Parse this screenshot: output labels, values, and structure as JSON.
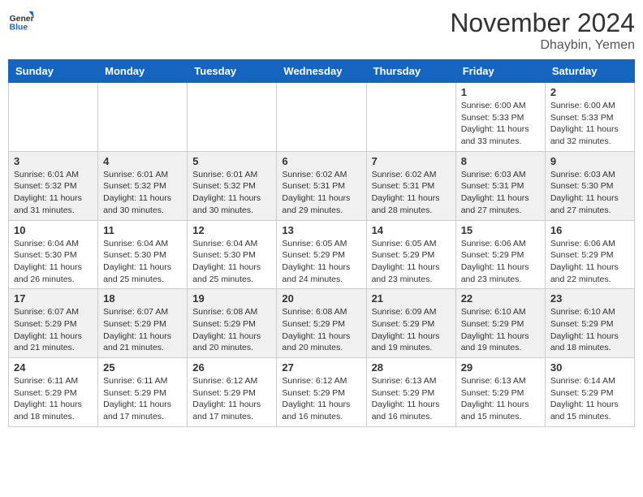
{
  "header": {
    "logo_general": "General",
    "logo_blue": "Blue",
    "month_title": "November 2024",
    "location": "Dhaybin, Yemen"
  },
  "weekdays": [
    "Sunday",
    "Monday",
    "Tuesday",
    "Wednesday",
    "Thursday",
    "Friday",
    "Saturday"
  ],
  "weeks": [
    [
      {
        "day": "",
        "info": ""
      },
      {
        "day": "",
        "info": ""
      },
      {
        "day": "",
        "info": ""
      },
      {
        "day": "",
        "info": ""
      },
      {
        "day": "",
        "info": ""
      },
      {
        "day": "1",
        "info": "Sunrise: 6:00 AM\nSunset: 5:33 PM\nDaylight: 11 hours\nand 33 minutes."
      },
      {
        "day": "2",
        "info": "Sunrise: 6:00 AM\nSunset: 5:33 PM\nDaylight: 11 hours\nand 32 minutes."
      }
    ],
    [
      {
        "day": "3",
        "info": "Sunrise: 6:01 AM\nSunset: 5:32 PM\nDaylight: 11 hours\nand 31 minutes."
      },
      {
        "day": "4",
        "info": "Sunrise: 6:01 AM\nSunset: 5:32 PM\nDaylight: 11 hours\nand 30 minutes."
      },
      {
        "day": "5",
        "info": "Sunrise: 6:01 AM\nSunset: 5:32 PM\nDaylight: 11 hours\nand 30 minutes."
      },
      {
        "day": "6",
        "info": "Sunrise: 6:02 AM\nSunset: 5:31 PM\nDaylight: 11 hours\nand 29 minutes."
      },
      {
        "day": "7",
        "info": "Sunrise: 6:02 AM\nSunset: 5:31 PM\nDaylight: 11 hours\nand 28 minutes."
      },
      {
        "day": "8",
        "info": "Sunrise: 6:03 AM\nSunset: 5:31 PM\nDaylight: 11 hours\nand 27 minutes."
      },
      {
        "day": "9",
        "info": "Sunrise: 6:03 AM\nSunset: 5:30 PM\nDaylight: 11 hours\nand 27 minutes."
      }
    ],
    [
      {
        "day": "10",
        "info": "Sunrise: 6:04 AM\nSunset: 5:30 PM\nDaylight: 11 hours\nand 26 minutes."
      },
      {
        "day": "11",
        "info": "Sunrise: 6:04 AM\nSunset: 5:30 PM\nDaylight: 11 hours\nand 25 minutes."
      },
      {
        "day": "12",
        "info": "Sunrise: 6:04 AM\nSunset: 5:30 PM\nDaylight: 11 hours\nand 25 minutes."
      },
      {
        "day": "13",
        "info": "Sunrise: 6:05 AM\nSunset: 5:29 PM\nDaylight: 11 hours\nand 24 minutes."
      },
      {
        "day": "14",
        "info": "Sunrise: 6:05 AM\nSunset: 5:29 PM\nDaylight: 11 hours\nand 23 minutes."
      },
      {
        "day": "15",
        "info": "Sunrise: 6:06 AM\nSunset: 5:29 PM\nDaylight: 11 hours\nand 23 minutes."
      },
      {
        "day": "16",
        "info": "Sunrise: 6:06 AM\nSunset: 5:29 PM\nDaylight: 11 hours\nand 22 minutes."
      }
    ],
    [
      {
        "day": "17",
        "info": "Sunrise: 6:07 AM\nSunset: 5:29 PM\nDaylight: 11 hours\nand 21 minutes."
      },
      {
        "day": "18",
        "info": "Sunrise: 6:07 AM\nSunset: 5:29 PM\nDaylight: 11 hours\nand 21 minutes."
      },
      {
        "day": "19",
        "info": "Sunrise: 6:08 AM\nSunset: 5:29 PM\nDaylight: 11 hours\nand 20 minutes."
      },
      {
        "day": "20",
        "info": "Sunrise: 6:08 AM\nSunset: 5:29 PM\nDaylight: 11 hours\nand 20 minutes."
      },
      {
        "day": "21",
        "info": "Sunrise: 6:09 AM\nSunset: 5:29 PM\nDaylight: 11 hours\nand 19 minutes."
      },
      {
        "day": "22",
        "info": "Sunrise: 6:10 AM\nSunset: 5:29 PM\nDaylight: 11 hours\nand 19 minutes."
      },
      {
        "day": "23",
        "info": "Sunrise: 6:10 AM\nSunset: 5:29 PM\nDaylight: 11 hours\nand 18 minutes."
      }
    ],
    [
      {
        "day": "24",
        "info": "Sunrise: 6:11 AM\nSunset: 5:29 PM\nDaylight: 11 hours\nand 18 minutes."
      },
      {
        "day": "25",
        "info": "Sunrise: 6:11 AM\nSunset: 5:29 PM\nDaylight: 11 hours\nand 17 minutes."
      },
      {
        "day": "26",
        "info": "Sunrise: 6:12 AM\nSunset: 5:29 PM\nDaylight: 11 hours\nand 17 minutes."
      },
      {
        "day": "27",
        "info": "Sunrise: 6:12 AM\nSunset: 5:29 PM\nDaylight: 11 hours\nand 16 minutes."
      },
      {
        "day": "28",
        "info": "Sunrise: 6:13 AM\nSunset: 5:29 PM\nDaylight: 11 hours\nand 16 minutes."
      },
      {
        "day": "29",
        "info": "Sunrise: 6:13 AM\nSunset: 5:29 PM\nDaylight: 11 hours\nand 15 minutes."
      },
      {
        "day": "30",
        "info": "Sunrise: 6:14 AM\nSunset: 5:29 PM\nDaylight: 11 hours\nand 15 minutes."
      }
    ]
  ]
}
